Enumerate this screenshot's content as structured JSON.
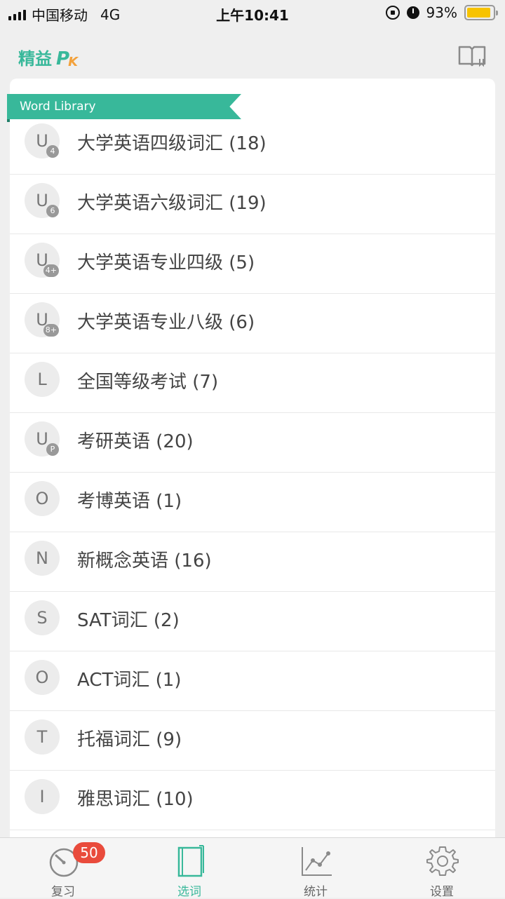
{
  "status": {
    "carrier": "中国移动",
    "network": "4G",
    "time": "上午10:41",
    "battery": "93%",
    "battery_level": 0.93
  },
  "app": {
    "logo_cn": "精益",
    "logo_p": "P",
    "logo_k": "K"
  },
  "library": {
    "title": "Word Library",
    "items": [
      {
        "letter": "U",
        "sub": "4",
        "label": "大学英语四级词汇 (18)"
      },
      {
        "letter": "U",
        "sub": "6",
        "label": "大学英语六级词汇 (19)"
      },
      {
        "letter": "U",
        "sub": "4+",
        "label": "大学英语专业四级 (5)"
      },
      {
        "letter": "U",
        "sub": "8+",
        "label": "大学英语专业八级 (6)"
      },
      {
        "letter": "L",
        "sub": "",
        "label": "全国等级考试 (7)"
      },
      {
        "letter": "U",
        "sub": "P",
        "label": "考研英语 (20)"
      },
      {
        "letter": "O",
        "sub": "",
        "label": "考博英语 (1)"
      },
      {
        "letter": "N",
        "sub": "",
        "label": "新概念英语 (16)"
      },
      {
        "letter": "S",
        "sub": "",
        "label": "SAT词汇 (2)"
      },
      {
        "letter": "O",
        "sub": "",
        "label": "ACT词汇 (1)"
      },
      {
        "letter": "T",
        "sub": "",
        "label": "托福词汇 (9)"
      },
      {
        "letter": "I",
        "sub": "",
        "label": "雅思词汇 (10)"
      }
    ]
  },
  "tabs": {
    "review": {
      "label": "复习",
      "badge": "50",
      "icon": "timer-icon"
    },
    "choose": {
      "label": "选词",
      "icon": "book-icon"
    },
    "stats": {
      "label": "统计",
      "icon": "chart-icon"
    },
    "settings": {
      "label": "设置",
      "icon": "gear-icon"
    }
  },
  "colors": {
    "accent": "#38b89a",
    "badge": "#e94b3c",
    "logo_k": "#f3a13a"
  }
}
